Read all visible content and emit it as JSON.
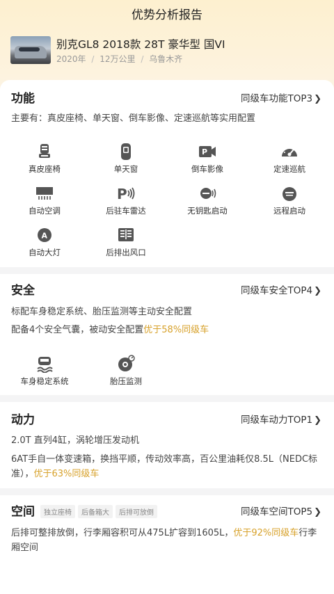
{
  "header": {
    "title": "优势分析报告"
  },
  "car": {
    "title": "别克GL8 2018款 28T 豪华型 国VI",
    "year": "2020年",
    "mileage": "12万公里",
    "city": "乌鲁木齐",
    "sep": "/"
  },
  "colors": {
    "highlight": "#d7a12a",
    "accent_bg": "#fdf0cf"
  },
  "sections": {
    "function": {
      "title": "功能",
      "link": "同级车功能TOP3",
      "desc": "主要有：真皮座椅、单天窗、倒车影像、定速巡航等实用配置",
      "features": [
        {
          "label": "真皮座椅",
          "icon": "leather-seat-icon"
        },
        {
          "label": "单天窗",
          "icon": "sunroof-icon"
        },
        {
          "label": "倒车影像",
          "icon": "reverse-camera-icon"
        },
        {
          "label": "定速巡航",
          "icon": "cruise-control-icon"
        },
        {
          "label": "自动空调",
          "icon": "auto-ac-icon"
        },
        {
          "label": "后驻车雷达",
          "icon": "parking-radar-icon"
        },
        {
          "label": "无钥匙启动",
          "icon": "keyless-start-icon"
        },
        {
          "label": "远程启动",
          "icon": "remote-start-icon"
        },
        {
          "label": "自动大灯",
          "icon": "auto-headlight-icon"
        },
        {
          "label": "后排出风口",
          "icon": "rear-vent-icon"
        }
      ]
    },
    "safety": {
      "title": "安全",
      "link": "同级车安全TOP4",
      "desc1": "标配车身稳定系统、胎压监测等主动安全配置",
      "desc2_prefix": "配备4个安全气囊，被动安全配置",
      "desc2_highlight": "优于58%同级车",
      "features": [
        {
          "label": "车身稳定系统",
          "icon": "stability-control-icon"
        },
        {
          "label": "胎压监测",
          "icon": "tire-pressure-icon"
        }
      ]
    },
    "power": {
      "title": "动力",
      "link": "同级车动力TOP1",
      "desc1": "2.0T 直列4缸，涡轮增压发动机",
      "desc2_prefix": "6AT手自一体变速箱，换挡平顺，传动效率高，百公里油耗仅8.5L（NEDC标准），",
      "desc2_highlight": "优于63%同级车"
    },
    "space": {
      "title": "空间",
      "tags": [
        "独立座椅",
        "后备箱大",
        "后排可放倒"
      ],
      "link": "同级车空间TOP5",
      "desc_prefix": "后排可整排放倒，行李厢容积可从475L扩容到1605L，",
      "desc_highlight": "优于92%同级车",
      "desc_suffix": "行李厢空间"
    }
  }
}
